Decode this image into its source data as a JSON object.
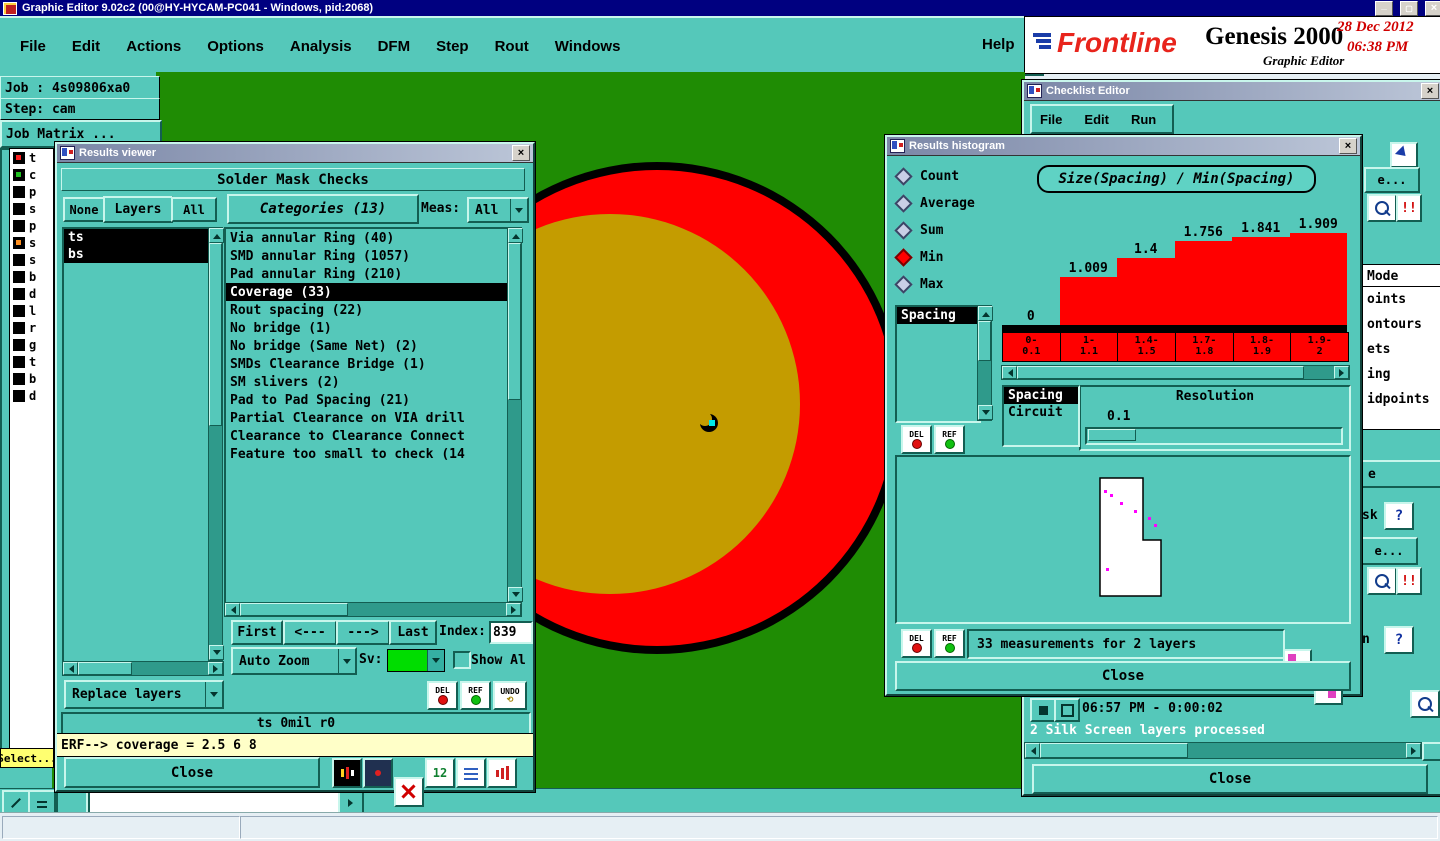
{
  "window": {
    "title": "Graphic Editor 9.02c2 (00@HY-HYCAM-PC041 - Windows, pid:2068)"
  },
  "menubar": {
    "items": [
      "File",
      "Edit",
      "Actions",
      "Options",
      "Analysis",
      "DFM",
      "Step",
      "Rout",
      "Windows"
    ],
    "help": "Help"
  },
  "brand": {
    "logo": "Frontline",
    "product": "Genesis 2000",
    "edition": "Graphic Editor",
    "date": "28 Dec 2012",
    "time": "06:38 PM"
  },
  "job_panel": {
    "job": "Job : 4s09806xa0",
    "step": "Step: cam",
    "matrix": "Job Matrix ..."
  },
  "layer_panel": {
    "letters": [
      "t",
      "c",
      "p",
      "s",
      "p",
      "s",
      "s",
      "b",
      "d",
      "l",
      "r",
      "g",
      "t",
      "b",
      "d"
    ]
  },
  "select_label": "Select...",
  "results_viewer": {
    "title": "Results viewer",
    "header": "Solder Mask Checks",
    "filters": [
      "None",
      "Layers",
      "All"
    ],
    "categories_button": "Categories (13)",
    "meas_label": "Meas:",
    "meas_value": "All",
    "layer_items": [
      "ts",
      "bs"
    ],
    "categories": [
      "Via annular Ring (40)",
      "SMD annular Ring (1057)",
      "Pad annular Ring (210)",
      "Coverage (33)",
      "Rout spacing (22)",
      "No bridge (1)",
      "No bridge (Same Net) (2)",
      "SMDs Clearance Bridge (1)",
      "SM slivers (2)",
      "Pad to Pad Spacing (21)",
      "Partial Clearance on VIA drill",
      "Clearance to Clearance Connect",
      "Feature too small to check (14"
    ],
    "selected_category": "Coverage (33)",
    "nav": {
      "first": "First",
      "prev": "<---",
      "next": "--->",
      "last": "Last",
      "index_label": "Index:",
      "index_value": "839"
    },
    "auto_zoom": "Auto Zoom",
    "sv_label": "Sv:",
    "sv_color": "#00dd00",
    "show_all_label": "Show Al",
    "replace_layers": "Replace layers",
    "del_label": "DEL",
    "ref_label": "REF",
    "undo_label": "UNDO",
    "status_line": "ts 0mil r0",
    "erf_line": "ERF--> coverage = 2.5 6 8",
    "close_label": "Close"
  },
  "histogram": {
    "title": "Results histogram",
    "stats": [
      "Count",
      "Average",
      "Sum",
      "Min",
      "Max"
    ],
    "selected_stat": "Min",
    "series_list": [
      "Spacing"
    ],
    "measure_list": [
      "Spacing",
      "Circuit"
    ],
    "resolution_label": "Resolution",
    "resolution_value": "0.1",
    "del_label": "DEL",
    "ref_label": "REF",
    "measurements_text": "33 measurements for 2 layers",
    "close_label": "Close"
  },
  "chart_data": {
    "type": "bar",
    "title": "Size(Spacing) / Min(Spacing)",
    "categories": [
      [
        "0-",
        "0.1"
      ],
      [
        "1-",
        "1.1"
      ],
      [
        "1.4-",
        "1.5"
      ],
      [
        "1.7-",
        "1.8"
      ],
      [
        "1.8-",
        "1.9"
      ],
      [
        "1.9-",
        "2"
      ]
    ],
    "values": [
      0,
      1.009,
      1.4,
      1.756,
      1.841,
      1.909
    ],
    "value_labels": [
      "0",
      "1.009",
      "1.4",
      "1.756",
      "1.841",
      "1.909"
    ],
    "ylim": [
      0,
      2
    ],
    "bar_color": "#ff0000",
    "xlabel": "",
    "ylabel": "",
    "legend": "none",
    "grid": false
  },
  "checklist": {
    "title": "Checklist Editor",
    "menu": [
      "File",
      "Edit",
      "Run"
    ],
    "mode_header": "Mode",
    "mode_items": [
      "oints",
      "ontours",
      "ets",
      "ing",
      "idpoints"
    ],
    "fragments": {
      "bar_e": "e",
      "sk": "sk",
      "n": "n",
      "ellipsis_btn": "e...",
      "alert": "!!",
      "help": "?"
    },
    "status_time": "06:57 PM - 0:00:02",
    "status_text": "2 Silk Screen layers processed",
    "close_label": "Close"
  }
}
